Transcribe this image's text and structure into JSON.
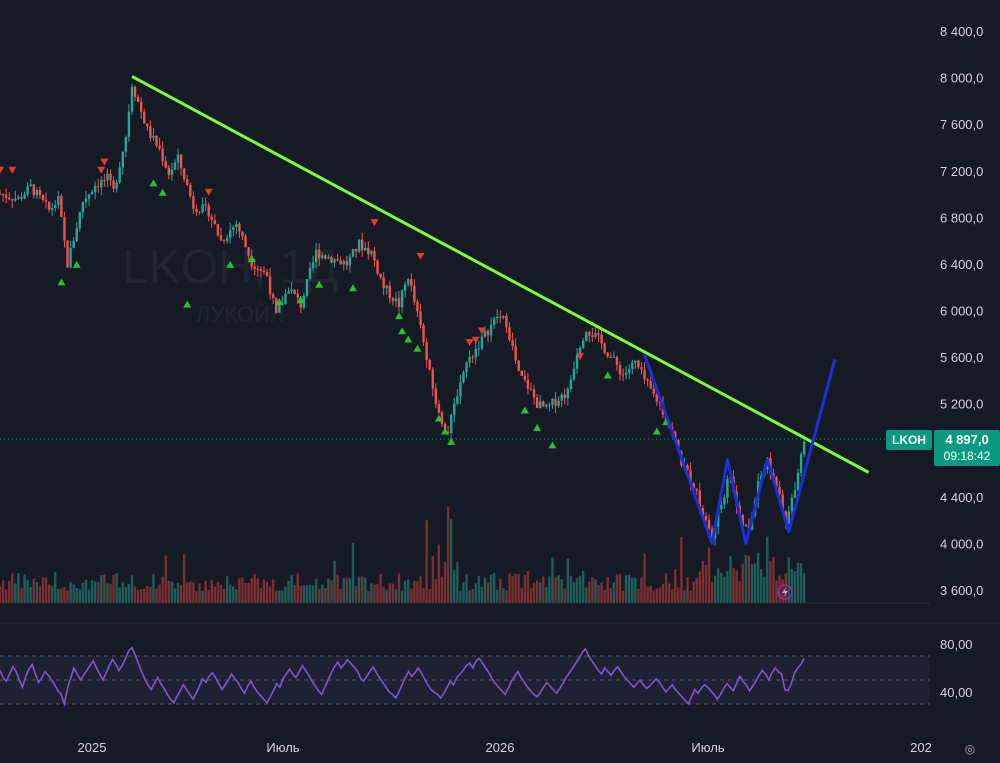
{
  "chart_data": {
    "type": "candlestick",
    "watermark": {
      "ticker": "LKOH, 1Д",
      "name": "ЛУКОЙЛ"
    },
    "price_axis_labels": [
      "8 400,0",
      "8 000,0",
      "7 600,0",
      "7 200,0",
      "6 800,0",
      "6 400,0",
      "6 000,0",
      "5 600,0",
      "5 200,0",
      "4 400,0",
      "4 000,0",
      "3 600,0"
    ],
    "price_axis_values": [
      8400,
      8000,
      7600,
      7200,
      6800,
      6400,
      6000,
      5600,
      5200,
      4400,
      4000,
      3600
    ],
    "y_range": [
      3500,
      8500
    ],
    "time_axis_labels": [
      "2025",
      "Июль",
      "2026",
      "Июль",
      "202"
    ],
    "last_price": {
      "ticker": "LKOH",
      "price": "4 897,0",
      "countdown": "09:18:42",
      "value": 4897
    },
    "price_path": [
      {
        "t": 0,
        "p": 7000
      },
      {
        "t": 6,
        "p": 6960
      },
      {
        "t": 10,
        "p": 7060
      },
      {
        "t": 16,
        "p": 6860
      },
      {
        "t": 19,
        "p": 6950
      },
      {
        "t": 22,
        "p": 6400
      },
      {
        "t": 27,
        "p": 6940
      },
      {
        "t": 31,
        "p": 7080
      },
      {
        "t": 35,
        "p": 7130
      },
      {
        "t": 37,
        "p": 7020
      },
      {
        "t": 41,
        "p": 7500
      },
      {
        "t": 43,
        "p": 7950
      },
      {
        "t": 48,
        "p": 7550
      },
      {
        "t": 52,
        "p": 7380
      },
      {
        "t": 55,
        "p": 7180
      },
      {
        "t": 58,
        "p": 7300
      },
      {
        "t": 60,
        "p": 7150
      },
      {
        "t": 63,
        "p": 6900
      },
      {
        "t": 68,
        "p": 6850
      },
      {
        "t": 72,
        "p": 6600
      },
      {
        "t": 77,
        "p": 6750
      },
      {
        "t": 82,
        "p": 6420
      },
      {
        "t": 87,
        "p": 6300
      },
      {
        "t": 90,
        "p": 5950
      },
      {
        "t": 94,
        "p": 6200
      },
      {
        "t": 98,
        "p": 6050
      },
      {
        "t": 103,
        "p": 6500
      },
      {
        "t": 108,
        "p": 6450
      },
      {
        "t": 113,
        "p": 6400
      },
      {
        "t": 117,
        "p": 6570
      },
      {
        "t": 121,
        "p": 6500
      },
      {
        "t": 125,
        "p": 6200
      },
      {
        "t": 130,
        "p": 6050
      },
      {
        "t": 133,
        "p": 6300
      },
      {
        "t": 137,
        "p": 5850
      },
      {
        "t": 140,
        "p": 5450
      },
      {
        "t": 143,
        "p": 5100
      },
      {
        "t": 146,
        "p": 4950
      },
      {
        "t": 149,
        "p": 5300
      },
      {
        "t": 152,
        "p": 5550
      },
      {
        "t": 157,
        "p": 5750
      },
      {
        "t": 162,
        "p": 5950
      },
      {
        "t": 165,
        "p": 5900
      },
      {
        "t": 169,
        "p": 5450
      },
      {
        "t": 172,
        "p": 5350
      },
      {
        "t": 175,
        "p": 5200
      },
      {
        "t": 178,
        "p": 5150
      },
      {
        "t": 182,
        "p": 5250
      },
      {
        "t": 185,
        "p": 5300
      },
      {
        "t": 188,
        "p": 5650
      },
      {
        "t": 191,
        "p": 5850
      },
      {
        "t": 195,
        "p": 5750
      },
      {
        "t": 199,
        "p": 5600
      },
      {
        "t": 203,
        "p": 5450
      },
      {
        "t": 207,
        "p": 5550
      },
      {
        "t": 211,
        "p": 5350
      },
      {
        "t": 215,
        "p": 5200
      },
      {
        "t": 219,
        "p": 4950
      },
      {
        "t": 222,
        "p": 4700
      },
      {
        "t": 226,
        "p": 4500
      },
      {
        "t": 229,
        "p": 4250
      },
      {
        "t": 232,
        "p": 4050
      },
      {
        "t": 235,
        "p": 4350
      },
      {
        "t": 238,
        "p": 4600
      },
      {
        "t": 241,
        "p": 4200
      },
      {
        "t": 244,
        "p": 4100
      },
      {
        "t": 247,
        "p": 4550
      },
      {
        "t": 250,
        "p": 4700
      },
      {
        "t": 253,
        "p": 4500
      },
      {
        "t": 256,
        "p": 4150
      },
      {
        "t": 259,
        "p": 4500
      },
      {
        "t": 262,
        "p": 4897
      }
    ],
    "trendline": {
      "points": [
        {
          "t": 43,
          "p": 8010
        },
        {
          "t": 283,
          "p": 4610
        }
      ],
      "color": "#7cfc3c"
    },
    "pattern_line": {
      "points": [
        {
          "t": 210,
          "p": 5620
        },
        {
          "t": 232,
          "p": 4000
        },
        {
          "t": 237,
          "p": 4720
        },
        {
          "t": 243,
          "p": 4000
        },
        {
          "t": 250,
          "p": 4720
        },
        {
          "t": 257,
          "p": 4100
        },
        {
          "t": 272,
          "p": 5580
        }
      ],
      "color": "#1a2fd4"
    },
    "buy_signals": [
      {
        "t": 20,
        "p": 6250
      },
      {
        "t": 25,
        "p": 6400
      },
      {
        "t": 50,
        "p": 7100
      },
      {
        "t": 53,
        "p": 7020
      },
      {
        "t": 61,
        "p": 6060
      },
      {
        "t": 75,
        "p": 6400
      },
      {
        "t": 82,
        "p": 6450
      },
      {
        "t": 91,
        "p": 6080
      },
      {
        "t": 98,
        "p": 6100
      },
      {
        "t": 104,
        "p": 6230
      },
      {
        "t": 115,
        "p": 6200
      },
      {
        "t": 130,
        "p": 5960
      },
      {
        "t": 131,
        "p": 5830
      },
      {
        "t": 133,
        "p": 5760
      },
      {
        "t": 136,
        "p": 5680
      },
      {
        "t": 143,
        "p": 5080
      },
      {
        "t": 145,
        "p": 4970
      },
      {
        "t": 147,
        "p": 4880
      },
      {
        "t": 171,
        "p": 5150
      },
      {
        "t": 175,
        "p": 5000
      },
      {
        "t": 180,
        "p": 4850
      },
      {
        "t": 198,
        "p": 5450
      },
      {
        "t": 214,
        "p": 4970
      },
      {
        "t": 217,
        "p": 5050
      }
    ],
    "sell_signals": [
      {
        "t": 0,
        "p": 7200
      },
      {
        "t": 4,
        "p": 7200
      },
      {
        "t": 33,
        "p": 7200
      },
      {
        "t": 34,
        "p": 7270
      },
      {
        "t": 68,
        "p": 7010
      },
      {
        "t": 122,
        "p": 6750
      },
      {
        "t": 137,
        "p": 6460
      },
      {
        "t": 153,
        "p": 5720
      },
      {
        "t": 155,
        "p": 5740
      },
      {
        "t": 157,
        "p": 5820
      },
      {
        "t": 189,
        "p": 5600
      }
    ],
    "volume_range": [
      0,
      1
    ],
    "rsi": {
      "y_range": [
        20,
        90
      ],
      "axis_labels": [
        "80,00",
        "40,00"
      ],
      "axis_values": [
        80,
        40
      ],
      "band": [
        30,
        70
      ],
      "values": [
        58,
        52,
        49,
        55,
        61,
        57,
        50,
        44,
        53,
        59,
        63,
        55,
        48,
        52,
        57,
        54,
        50,
        46,
        41,
        38,
        30,
        43,
        52,
        60,
        55,
        50,
        54,
        58,
        62,
        66,
        60,
        55,
        50,
        56,
        62,
        67,
        63,
        58,
        62,
        68,
        74,
        77,
        71,
        64,
        57,
        51,
        46,
        42,
        47,
        52,
        47,
        43,
        38,
        34,
        31,
        36,
        41,
        46,
        42,
        38,
        34,
        39,
        45,
        51,
        48,
        53,
        56,
        52,
        47,
        42,
        46,
        50,
        55,
        51,
        48,
        43,
        39,
        45,
        49,
        44,
        40,
        37,
        34,
        31,
        36,
        41,
        47,
        44,
        51,
        55,
        59,
        55,
        52,
        57,
        62,
        58,
        54,
        49,
        45,
        41,
        38,
        44,
        50,
        56,
        61,
        65,
        60,
        63,
        67,
        64,
        61,
        58,
        52,
        49,
        53,
        57,
        61,
        56,
        52,
        48,
        44,
        40,
        38,
        35,
        40,
        46,
        52,
        57,
        53,
        56,
        60,
        56,
        51,
        46,
        42,
        40,
        38,
        35,
        39,
        44,
        49,
        46,
        52,
        55,
        58,
        62,
        64,
        60,
        66,
        68,
        64,
        60,
        56,
        51,
        47,
        44,
        41,
        38,
        43,
        49,
        53,
        57,
        52,
        48,
        44,
        41,
        38,
        36,
        40,
        44,
        48,
        45,
        42,
        39,
        43,
        47,
        52,
        56,
        60,
        64,
        68,
        73,
        76,
        70,
        66,
        62,
        58,
        55,
        60,
        57,
        54,
        58,
        61,
        57,
        53,
        50,
        47,
        44,
        47,
        50,
        46,
        43,
        45,
        48,
        51,
        48,
        44,
        40,
        43,
        46,
        42,
        39,
        36,
        33,
        30,
        36,
        42,
        39,
        43,
        46,
        44,
        41,
        38,
        34,
        38,
        43,
        47,
        44,
        41,
        47,
        53,
        49,
        46,
        41,
        45,
        49,
        54,
        58,
        55,
        50,
        56,
        60,
        57,
        55,
        42,
        41,
        47,
        56,
        60,
        63,
        68
      ]
    }
  }
}
